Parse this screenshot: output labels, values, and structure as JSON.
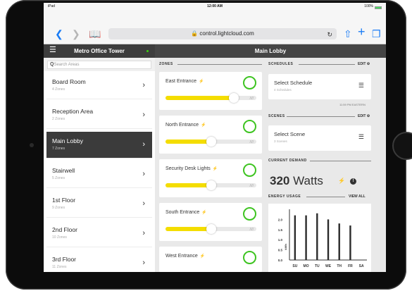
{
  "status_bar": {
    "device": "iPad",
    "time": "12:00 AM",
    "battery": "100%"
  },
  "browser": {
    "url": "control.lightcloud.com"
  },
  "sidebar": {
    "building_name": "Metro Office Tower",
    "search_placeholder": "Search Areas",
    "areas": [
      {
        "name": "Board Room",
        "zones": "4 Zones",
        "active": false
      },
      {
        "name": "Reception Area",
        "zones": "2 Zones",
        "active": false
      },
      {
        "name": "Main Lobby",
        "zones": "7 Zones",
        "active": true
      },
      {
        "name": "Stairwell",
        "zones": "5 Zones",
        "active": false
      },
      {
        "name": "1st Floor",
        "zones": "9 Zones",
        "active": false
      },
      {
        "name": "2nd Floor",
        "zones": "10 Zones",
        "active": false
      },
      {
        "name": "3rd Floor",
        "zones": "11 Zones",
        "active": false
      }
    ]
  },
  "main": {
    "title": "Main Lobby",
    "zones_label": "ZONES",
    "zones": [
      {
        "name": "East Entrance",
        "level": 0.75
      },
      {
        "name": "North Entrance",
        "level": 0.5
      },
      {
        "name": "Security Desk Lights",
        "level": 0.5
      },
      {
        "name": "South Entrance",
        "level": 0.5
      },
      {
        "name": "West Entrance",
        "level": 0.5
      }
    ],
    "schedules_label": "SCHEDULES",
    "schedules_edit": "EDIT",
    "schedule": {
      "title": "Select Schedule",
      "sub": "4 Schedules"
    },
    "timezone": "11:59 PM EASTERN",
    "scenes_label": "SCENES",
    "scenes_edit": "EDIT",
    "scene": {
      "title": "Select Scene",
      "sub": "3 Scenes"
    },
    "demand_label": "CURRENT DEMAND",
    "demand_value": "320",
    "demand_unit": "Watts",
    "energy_label": "ENERGY USAGE",
    "view_all": "VIEW ALL"
  },
  "colors": {
    "toggle_on": "#3ec421",
    "slider_fill": "#f4dd00",
    "header_dark": "#454545",
    "accent_blue": "#1a7cf5"
  },
  "chart_data": {
    "type": "bar",
    "categories": [
      "SU",
      "MO",
      "TU",
      "WE",
      "TH",
      "FR",
      "SA"
    ],
    "values": [
      2.2,
      2.2,
      2.3,
      2.0,
      1.8,
      1.7,
      0
    ],
    "ylabel": "kWh",
    "ticks": [
      "0.0",
      "0.5",
      "1.0",
      "1.5",
      "2.0"
    ],
    "ylim": [
      0,
      2.5
    ]
  }
}
